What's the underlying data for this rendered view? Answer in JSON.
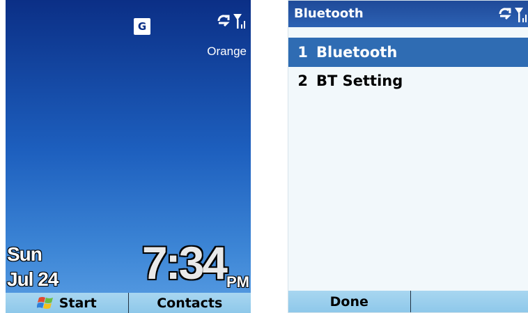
{
  "home": {
    "network_badge": "G",
    "carrier": "Orange",
    "day": "Sun",
    "date": "Jul 24",
    "time": "7:34",
    "ampm": "PM",
    "softkeys": {
      "left": "Start",
      "right": "Contacts"
    },
    "icons": [
      "network-g-icon",
      "data-connection-icon",
      "signal-strength-icon",
      "windows-flag-icon"
    ]
  },
  "bluetooth": {
    "title": "Bluetooth",
    "items": [
      {
        "num": "1",
        "label": "Bluetooth",
        "selected": true
      },
      {
        "num": "2",
        "label": "BT Setting",
        "selected": false
      }
    ],
    "softkeys": {
      "left": "Done",
      "right": ""
    },
    "icons": [
      "data-connection-icon",
      "signal-strength-icon"
    ]
  },
  "colors": {
    "title_bar": "#2d62b4",
    "selection": "#2f6cb3",
    "softkey_bar": "#9ccff0",
    "home_gradient_top": "#0b2f86"
  }
}
